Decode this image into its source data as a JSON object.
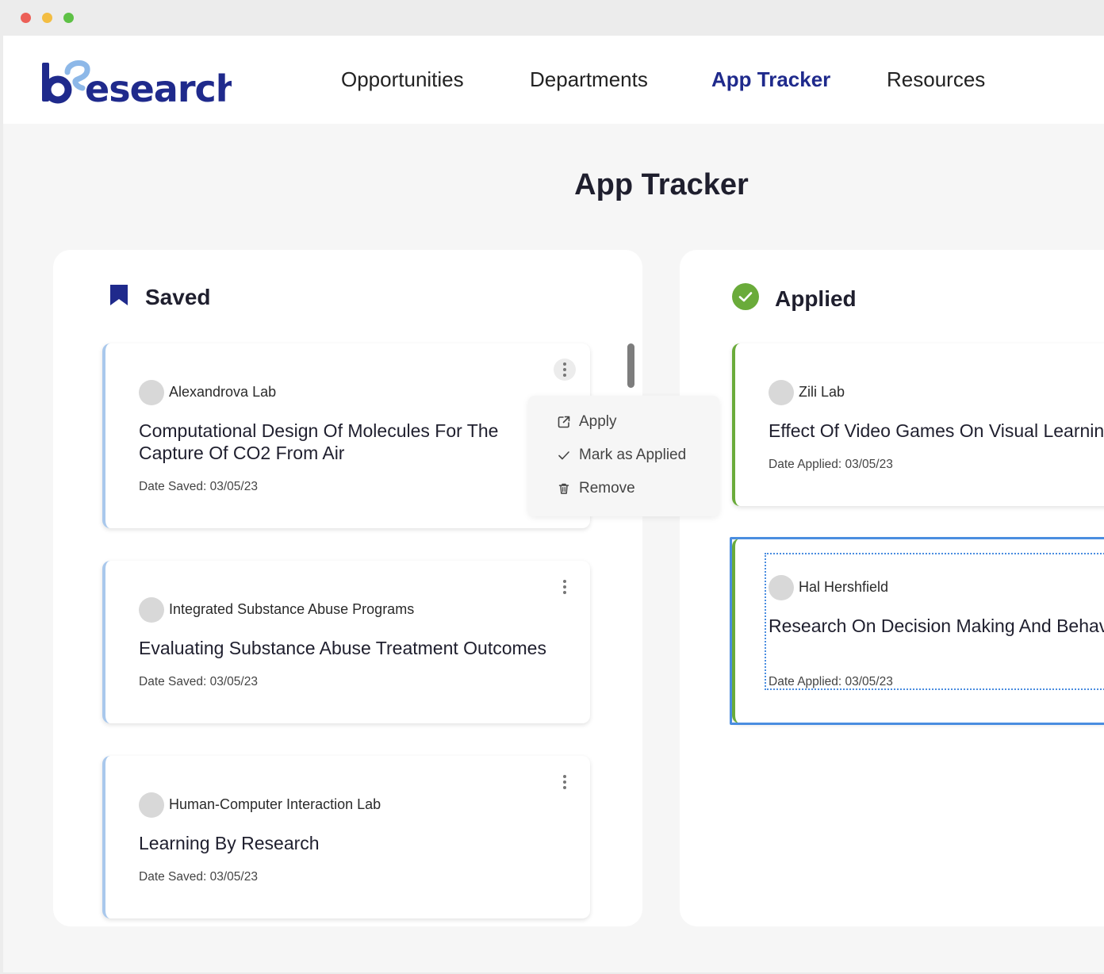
{
  "brand": {
    "logo_text": "bResearch"
  },
  "nav": {
    "items": [
      {
        "label": "Opportunities"
      },
      {
        "label": "Departments"
      },
      {
        "label": "App Tracker"
      },
      {
        "label": "Resources"
      }
    ],
    "active": "App Tracker"
  },
  "page": {
    "title": "App Tracker"
  },
  "saved": {
    "title": "Saved",
    "icon": "bookmark-icon",
    "color": "#1f2a8c",
    "cards": [
      {
        "org": "Alexandrova Lab",
        "title": "Computational Design Of Molecules For The Capture Of CO2 From Air",
        "date": "Date Saved: 03/05/23"
      },
      {
        "org": "Integrated Substance Abuse Programs",
        "title": "Evaluating Substance Abuse Treatment Outcomes",
        "date": "Date Saved: 03/05/23"
      },
      {
        "org": "Human-Computer Interaction Lab",
        "title": "Learning By Research",
        "date": "Date Saved: 03/05/23"
      }
    ]
  },
  "applied": {
    "title": "Applied",
    "icon": "check-circle-icon",
    "color": "#6aab3a",
    "cards": [
      {
        "org": "Zili Lab",
        "title": "Effect Of Video Games On Visual Learning",
        "date": "Date Applied: 03/05/23"
      },
      {
        "org": "Hal Hershfield",
        "title": "Research On Decision Making And Behavioral Science",
        "date": "Date Applied: 03/05/23"
      }
    ]
  },
  "context_menu": {
    "items": [
      {
        "label": "Apply",
        "icon": "external-link-icon"
      },
      {
        "label": "Mark as Applied",
        "icon": "check-icon"
      },
      {
        "label": "Remove",
        "icon": "trash-icon"
      }
    ]
  },
  "colors": {
    "brand_navy": "#1f2a8c",
    "brand_light_blue": "#8db8e8",
    "saved_accent": "#a9c8ec",
    "applied_accent": "#6aab3a",
    "drop_highlight": "#4a8de0"
  }
}
